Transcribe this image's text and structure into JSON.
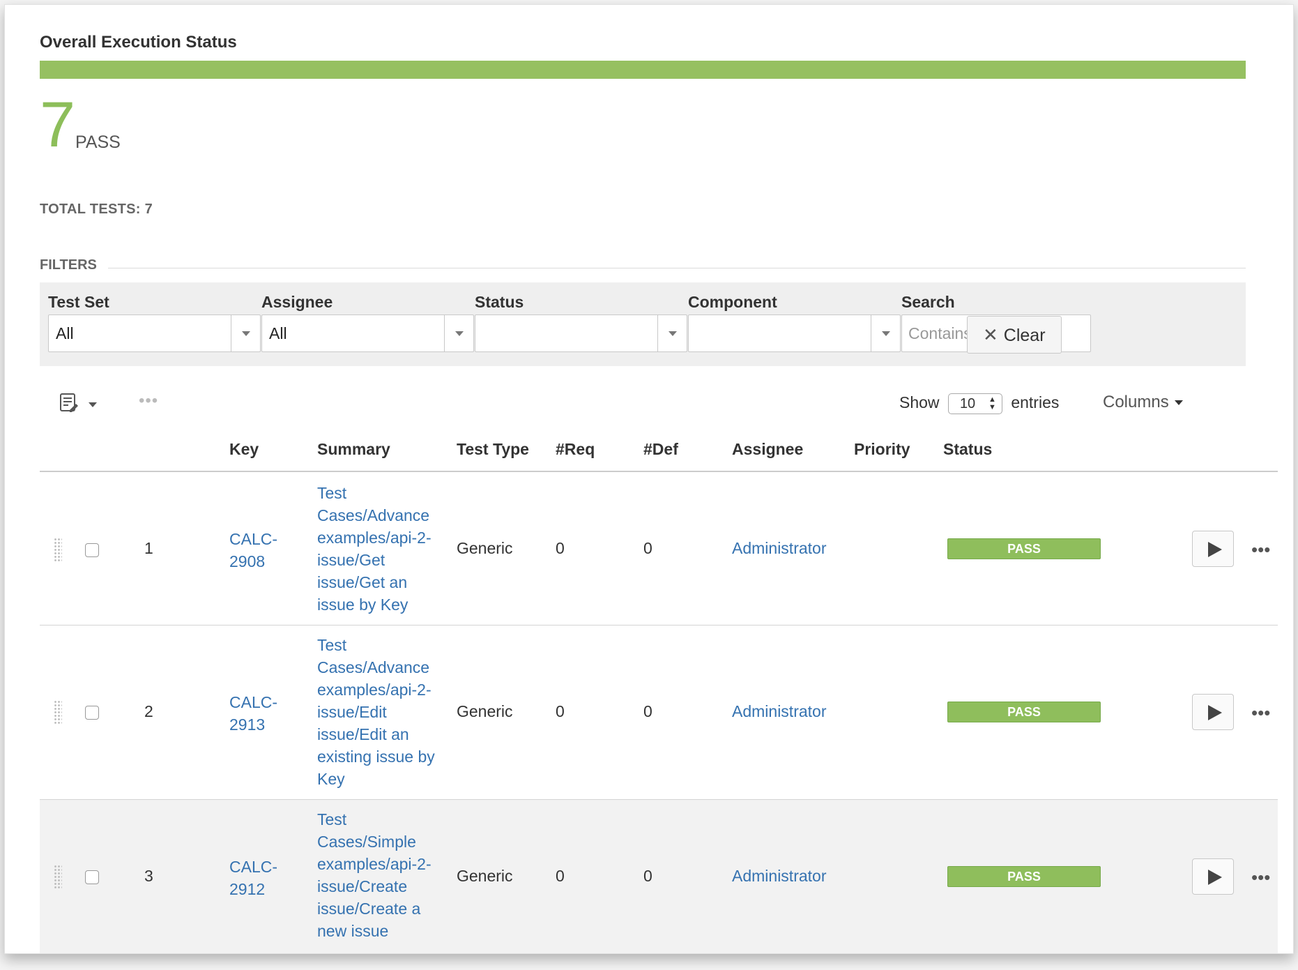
{
  "overall": {
    "title": "Overall Execution Status",
    "pass_count": "7",
    "pass_label": "PASS",
    "pass_fraction": 1.0,
    "total_label": "TOTAL TESTS: 7",
    "bar_color": "#96c061"
  },
  "filters": {
    "title": "FILTERS",
    "test_set": {
      "label": "Test Set",
      "value": "All"
    },
    "assignee": {
      "label": "Assignee",
      "value": "All"
    },
    "status": {
      "label": "Status",
      "value": ""
    },
    "component": {
      "label": "Component",
      "value": ""
    },
    "search": {
      "label": "Search",
      "placeholder": "Contains text",
      "value": ""
    },
    "clear_label": "Clear"
  },
  "toolbar": {
    "show_label": "Show",
    "entries_value": "10",
    "entries_label": "entries",
    "columns_label": "Columns"
  },
  "table": {
    "headers": {
      "key": "Key",
      "summary": "Summary",
      "test_type": "Test Type",
      "req": "#Req",
      "def": "#Def",
      "assignee": "Assignee",
      "priority": "Priority",
      "status": "Status"
    },
    "rows": [
      {
        "num": "1",
        "key": "CALC-2908",
        "summary": "Test Cases/Advance examples/api-2-issue/Get issue/Get an issue by Key",
        "test_type": "Generic",
        "req": "0",
        "def": "0",
        "assignee": "Administrator",
        "priority": "",
        "status": "PASS"
      },
      {
        "num": "2",
        "key": "CALC-2913",
        "summary": "Test Cases/Advance examples/api-2-issue/Edit issue/Edit an existing issue by Key",
        "test_type": "Generic",
        "req": "0",
        "def": "0",
        "assignee": "Administrator",
        "priority": "",
        "status": "PASS"
      },
      {
        "num": "3",
        "key": "CALC-2912",
        "summary": "Test Cases/Simple examples/api-2-issue/Create issue/Create a new issue",
        "test_type": "Generic",
        "req": "0",
        "def": "0",
        "assignee": "Administrator",
        "priority": "",
        "status": "PASS"
      }
    ]
  },
  "colors": {
    "pass": "#8fbe5c",
    "link": "#3572b0"
  },
  "icons": {
    "toolbar_menu": "list-edit-icon",
    "clear": "close-icon",
    "play": "play-icon",
    "more": "more-dots-icon",
    "drag": "drag-handle-icon"
  }
}
